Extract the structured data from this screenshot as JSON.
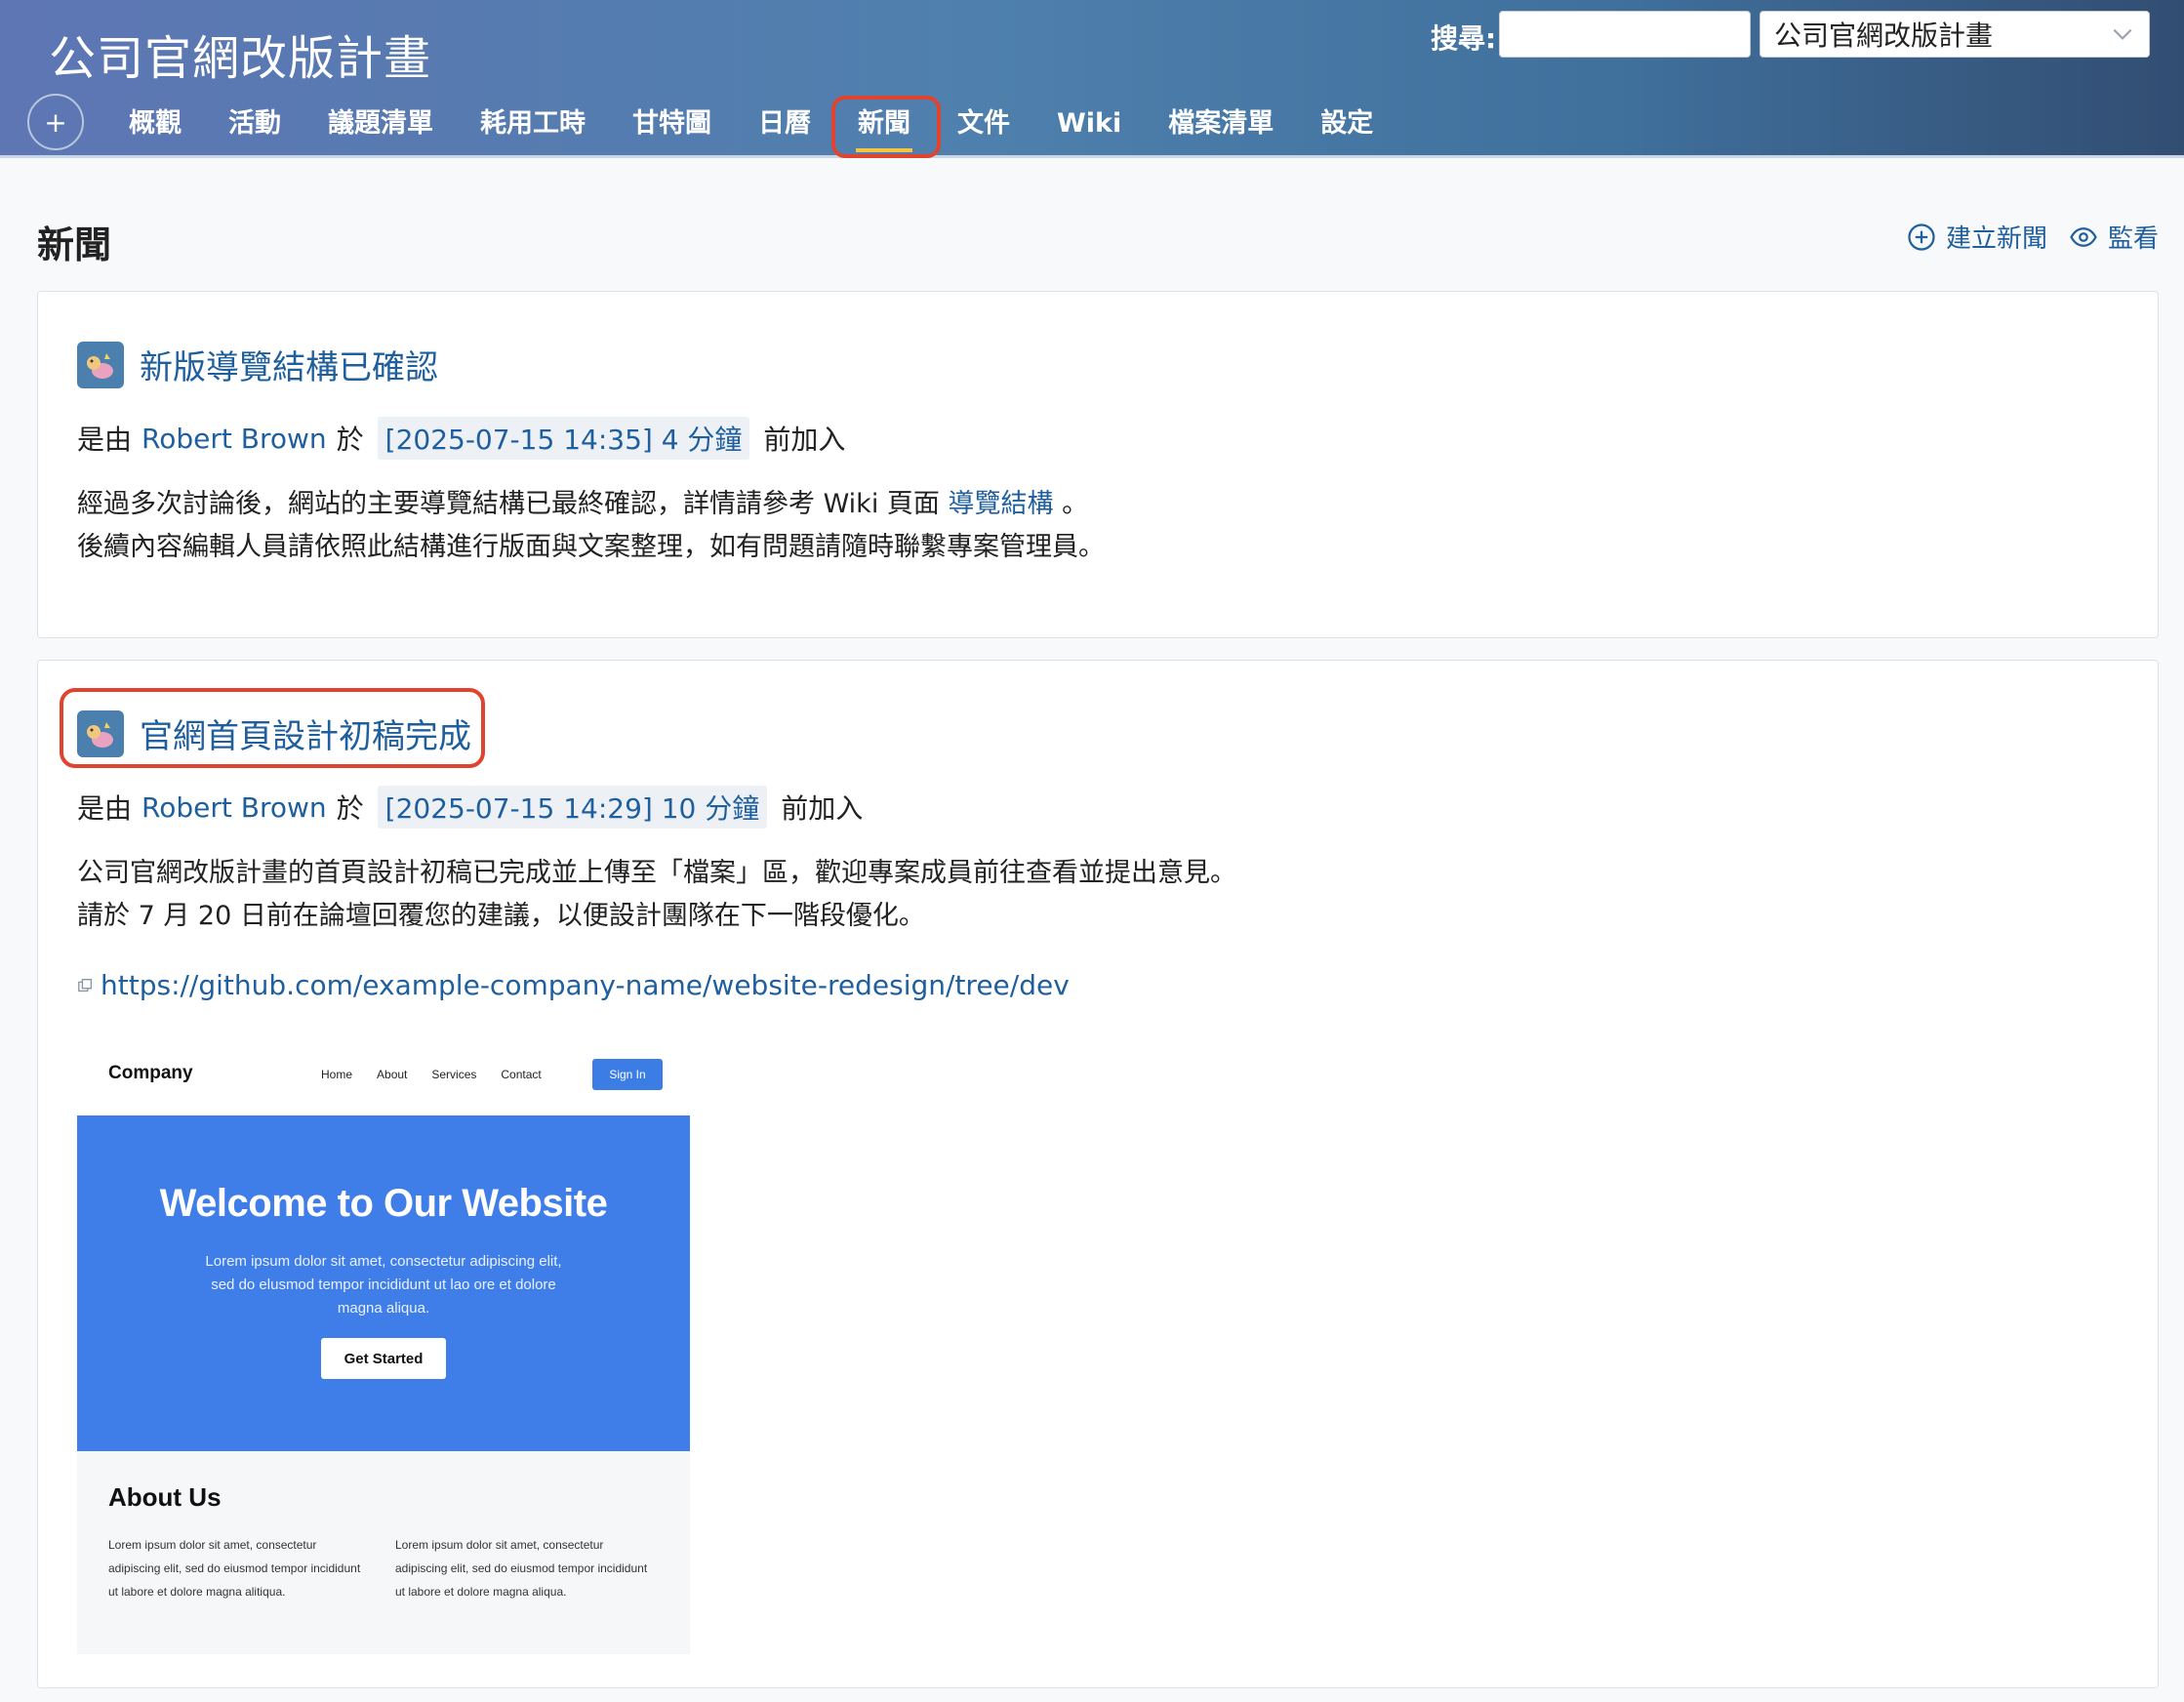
{
  "header": {
    "title": "公司官網改版計畫",
    "search_label": "搜尋:",
    "search_value": "",
    "project_select": "公司官網改版計畫",
    "plus_label": "+"
  },
  "tabs": [
    {
      "label": "概觀"
    },
    {
      "label": "活動"
    },
    {
      "label": "議題清單"
    },
    {
      "label": "耗用工時"
    },
    {
      "label": "甘特圖"
    },
    {
      "label": "日曆"
    },
    {
      "label": "新聞",
      "active": true
    },
    {
      "label": "文件"
    },
    {
      "label": "Wiki"
    },
    {
      "label": "檔案清單"
    },
    {
      "label": "設定"
    }
  ],
  "page": {
    "title": "新聞",
    "create_news": "建立新聞",
    "watch": "監看"
  },
  "news": [
    {
      "title": "新版導覽結構已確認",
      "by_prefix": "是由",
      "author": "Robert Brown",
      "at": "於",
      "timestamp": "[2025-07-15 14:35] 4 分鐘",
      "suffix": "前加入",
      "line1_pre": "經過多次討論後，網站的主要導覽結構已最終確認，詳情請參考 Wiki 頁面 ",
      "line1_link": "導覽結構",
      "line1_post": " 。",
      "line2": "後續內容編輯人員請依照此結構進行版面與文案整理，如有問題請隨時聯繫專案管理員。"
    },
    {
      "title": "官網首頁設計初稿完成",
      "by_prefix": "是由",
      "author": "Robert Brown",
      "at": "於",
      "timestamp": "[2025-07-15 14:29] 10 分鐘",
      "suffix": "前加入",
      "line1": "公司官網改版計畫的首頁設計初稿已完成並上傳至「檔案」區，歡迎專案成員前往查看並提出意見。",
      "line2": "請於 7 月 20 日前在論壇回覆您的建議，以便設計團隊在下一階段優化。",
      "url": "https://github.com/example-company-name/website-redesign/tree/dev"
    }
  ],
  "mockup": {
    "brand": "Company",
    "nav": [
      "Home",
      "About",
      "Services",
      "Contact"
    ],
    "signin": "Sign In",
    "hero_title": "Welcome to Our Website",
    "hero_text": "Lorem ipsum dolor sit amet, consectetur adipiscing elit, sed do elusmod tempor incididunt ut lao ore et dolore magna aliqua.",
    "cta": "Get Started",
    "about_title": "About Us",
    "col1": "Lorem ipsum dolor sit amet, consectetur adipiscing elit, sed do eiusmod tempor incididunt ut labore et dolore magna alitiqua.",
    "col2": "Lorem ipsum dolor sit amet, consectetur adipiscing elit, sed do eiusmod tempor incididunt ut labore et dolore magna aliqua."
  },
  "colors": {
    "link": "#1f5f9e",
    "highlight": "#e0432e",
    "hero": "#3f7de8"
  }
}
